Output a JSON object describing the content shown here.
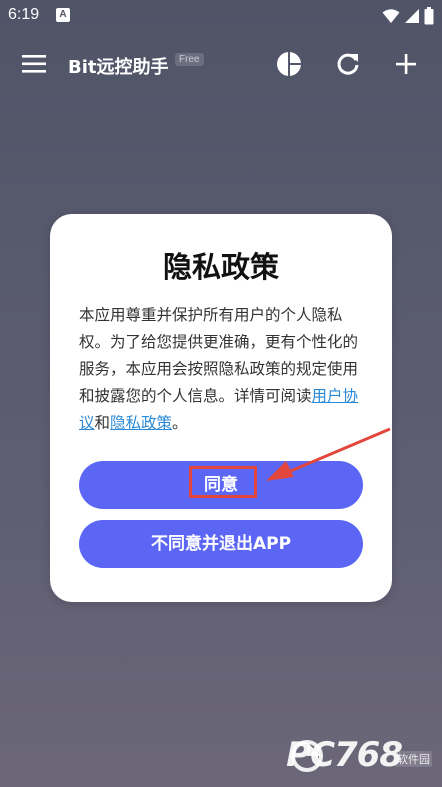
{
  "status_bar": {
    "time": "6:19",
    "app_icon_letter": "A",
    "icons": [
      "wifi-icon",
      "signal-icon",
      "battery-icon"
    ]
  },
  "toolbar": {
    "title": "Bit远控助手",
    "badge": "Free",
    "icons": [
      "menu-icon",
      "pie-chart-icon",
      "refresh-icon",
      "add-icon"
    ]
  },
  "dialog": {
    "title": "隐私政策",
    "body_prefix": "本应用尊重并保护所有用户的个人隐私权。为了给您提供更准确，更有个性化的服务，本应用会按照隐私政策的规定使用和披露您的个人信息。详情可阅读",
    "link_user_agreement": "用户协议",
    "conjunction": "和",
    "link_privacy_policy": "隐私政策",
    "body_suffix": "。",
    "agree_button": "同意",
    "disagree_button": "不同意并退出APP"
  },
  "annotation": {
    "highlight_color": "#e2463c"
  },
  "watermark": {
    "text": "PC768",
    "sub": "软件园"
  },
  "colors": {
    "accent": "#5b66f5",
    "link": "#2a8ad8",
    "background_top": "#505467",
    "background_bottom": "#6b6778"
  }
}
